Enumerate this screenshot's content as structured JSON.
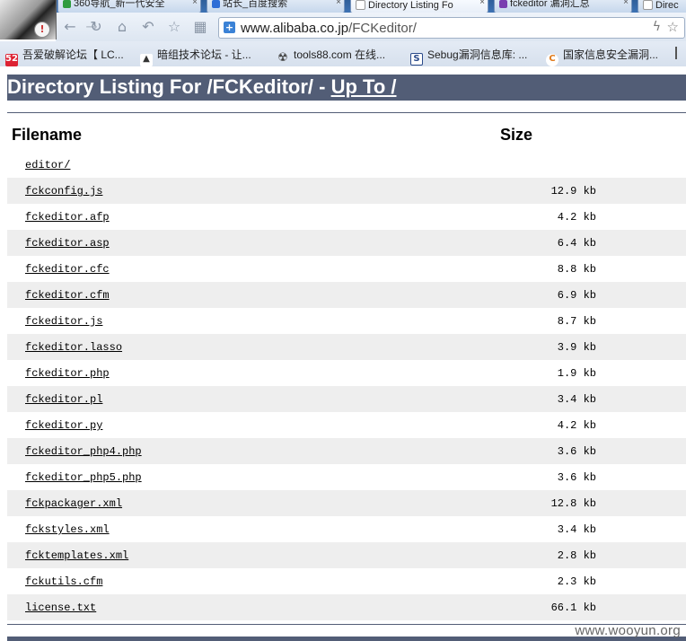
{
  "browser": {
    "tabs": [
      {
        "title": "360导航_新一代安全",
        "color": "#2e9b3e"
      },
      {
        "title": "站长_百度搜索",
        "color": "#2d6dd6"
      },
      {
        "title": "Directory Listing Fo",
        "color": "#ffffff"
      },
      {
        "title": "fckeditor 漏洞汇总",
        "color": "#7a3fb0"
      },
      {
        "title": "Direc",
        "color": "#ffffff"
      }
    ],
    "tab_close": "×",
    "url_host": "www.alibaba.co.jp",
    "url_path": "/FCKeditor/",
    "bookmarks": [
      {
        "label": "吾爱破解论坛【 LC...",
        "icon": "52",
        "color": "#d23"
      },
      {
        "label": "暗组技术论坛 - 让...",
        "icon": "▲",
        "color": "#333"
      },
      {
        "label": "tools88.com 在线...",
        "icon": "☢",
        "color": "#444"
      },
      {
        "label": "Sebug漏洞信息库: ...",
        "icon": "S",
        "color": "#2a4a8a"
      },
      {
        "label": "国家信息安全漏洞...",
        "icon": "C",
        "color": "#e07a1a"
      }
    ]
  },
  "page": {
    "heading_prefix": "Directory Listing For /FCKeditor/ - ",
    "heading_link": "Up To /",
    "col_filename": "Filename",
    "col_size": "Size",
    "files": [
      {
        "name": "editor/",
        "size": ""
      },
      {
        "name": "fckconfig.js",
        "size": "12.9 kb"
      },
      {
        "name": "fckeditor.afp",
        "size": "4.2 kb"
      },
      {
        "name": "fckeditor.asp",
        "size": "6.4 kb"
      },
      {
        "name": "fckeditor.cfc",
        "size": "8.8 kb"
      },
      {
        "name": "fckeditor.cfm",
        "size": "6.9 kb"
      },
      {
        "name": "fckeditor.js",
        "size": "8.7 kb"
      },
      {
        "name": "fckeditor.lasso",
        "size": "3.9 kb"
      },
      {
        "name": "fckeditor.php",
        "size": "1.9 kb"
      },
      {
        "name": "fckeditor.pl",
        "size": "3.4 kb"
      },
      {
        "name": "fckeditor.py",
        "size": "4.2 kb"
      },
      {
        "name": "fckeditor_php4.php",
        "size": "3.6 kb"
      },
      {
        "name": "fckeditor_php5.php",
        "size": "3.6 kb"
      },
      {
        "name": "fckpackager.xml",
        "size": "12.8 kb"
      },
      {
        "name": "fckstyles.xml",
        "size": "3.4 kb"
      },
      {
        "name": "fcktemplates.xml",
        "size": "2.8 kb"
      },
      {
        "name": "fckutils.cfm",
        "size": "2.3 kb"
      },
      {
        "name": "license.txt",
        "size": "66.1 kb"
      }
    ],
    "watermark": "www.wooyun.org"
  }
}
